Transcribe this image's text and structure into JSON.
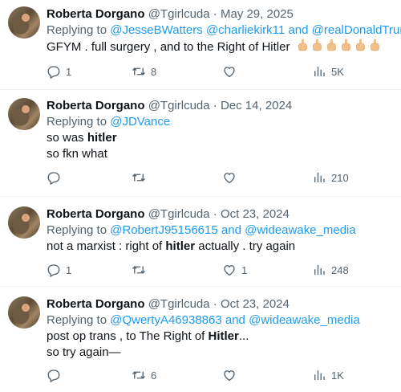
{
  "tweets": [
    {
      "name": "Roberta Dorgano",
      "handle": "@Tgirlcuda",
      "dot": "·",
      "date": "May 29, 2025",
      "reply_prefix": "Replying to",
      "mentions": [
        "@JesseBWatters",
        "@charliekirk11",
        "and",
        "@realDonaldTrump"
      ],
      "text": "GFYM . full surgery , and to the Right of Hitler",
      "emoji_name": "middle-finger-emoji",
      "reply_count": "1",
      "retweet_count": "8",
      "like_count": "",
      "views": "5K"
    },
    {
      "name": "Roberta Dorgano",
      "handle": "@Tgirlcuda",
      "dot": "·",
      "date": "Dec 14, 2024",
      "reply_prefix": "Replying to",
      "mentions": [
        "@JDVance"
      ],
      "text_line1_pre": "so was ",
      "text_line1_bold": "hitler",
      "text_line2": "so fkn what",
      "reply_count": "",
      "retweet_count": "",
      "like_count": "",
      "views": "210"
    },
    {
      "name": "Roberta Dorgano",
      "handle": "@Tgirlcuda",
      "dot": "·",
      "date": "Oct 23, 2024",
      "reply_prefix": "Replying to",
      "mentions": [
        "@RobertJ95156615",
        "and",
        "@wideawake_media"
      ],
      "text_pre": "not a marxist : right of ",
      "text_bold": "hitler",
      "text_post": " actually . try again",
      "reply_count": "1",
      "retweet_count": "",
      "like_count": "1",
      "views": "248"
    },
    {
      "name": "Roberta Dorgano",
      "handle": "@Tgirlcuda",
      "dot": "·",
      "date": "Oct 23, 2024",
      "reply_prefix": "Replying to",
      "mentions": [
        "@QwertyA46938863",
        "and",
        "@wideawake_media"
      ],
      "text_line1_pre": "post op trans  , to The Right of ",
      "text_line1_bold": "Hitler",
      "text_line1_post": "...",
      "text_line2": "so try again—",
      "reply_count": "",
      "retweet_count": "6",
      "like_count": "",
      "views": "1K"
    }
  ],
  "colors": {
    "link": "#1d9bf0",
    "secondary": "#536471",
    "primary": "#0f1419",
    "divider": "#eff3f4"
  },
  "icons": {
    "reply": "reply-icon",
    "retweet": "retweet-icon",
    "like": "heart-icon",
    "views": "views-icon"
  }
}
